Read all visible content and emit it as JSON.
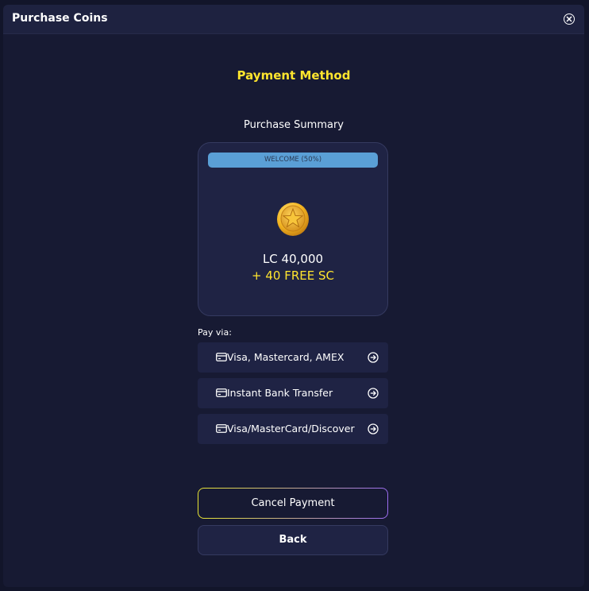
{
  "header": {
    "title": "Purchase Coins"
  },
  "page": {
    "heading": "Payment Method",
    "summary_label": "Purchase Summary"
  },
  "summary": {
    "promo": "WELCOME (50%)",
    "coin_amount": "LC 40,000",
    "bonus": "+ 40 FREE SC"
  },
  "payment": {
    "label": "Pay via:",
    "options": [
      {
        "label": "Visa, Mastercard, AMEX"
      },
      {
        "label": "Instant Bank Transfer"
      },
      {
        "label": "Visa/MasterCard/Discover"
      }
    ]
  },
  "actions": {
    "cancel_label": "Cancel Payment",
    "back_label": "Back"
  },
  "colors": {
    "accent_yellow": "#ffe52e",
    "promo_blue": "#5a9fd6",
    "background": "#171a33",
    "card": "#1f2344"
  },
  "icons": {
    "close": "close-circle-icon",
    "coin": "gold-star-coin-icon",
    "card": "credit-card-icon",
    "arrow": "arrow-right-circle-icon"
  }
}
